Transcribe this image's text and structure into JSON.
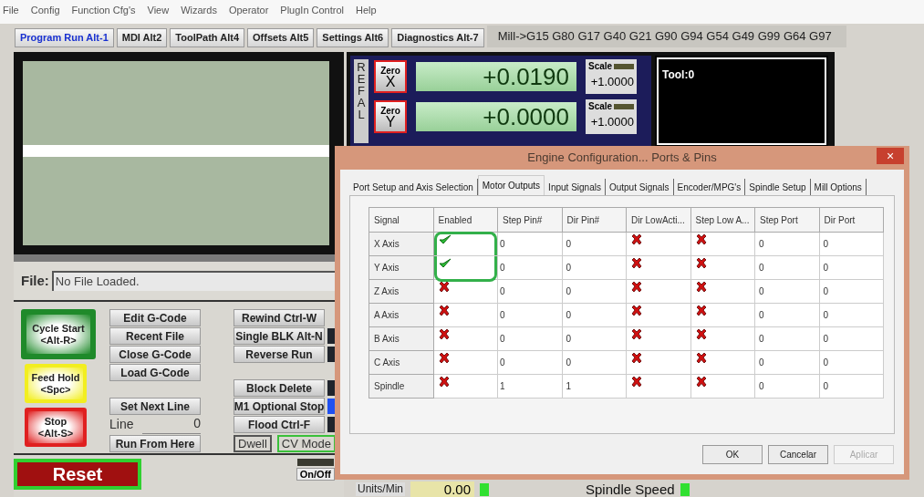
{
  "menu": [
    "File",
    "Config",
    "Function Cfg's",
    "View",
    "Wizards",
    "Operator",
    "PlugIn Control",
    "Help"
  ],
  "tabs": [
    {
      "label": "Program Run Alt-1",
      "selected": true
    },
    {
      "label": "MDI Alt2",
      "selected": false
    },
    {
      "label": "ToolPath Alt4",
      "selected": false
    },
    {
      "label": "Offsets Alt5",
      "selected": false
    },
    {
      "label": "Settings Alt6",
      "selected": false
    },
    {
      "label": "Diagnostics Alt-7",
      "selected": false
    }
  ],
  "modal_codes": "Mill->G15  G80 G17 G40 G21 G90 G94 G54 G49 G99 G64 G97",
  "file": {
    "label": "File:",
    "value": "No File Loaded."
  },
  "cycle_buttons": [
    {
      "lines": [
        "Cycle Start",
        "<Alt-R>"
      ],
      "color": "#1f8a2a"
    },
    {
      "lines": [
        "Feed Hold",
        "<Spc>"
      ],
      "color": "#f2ee20"
    },
    {
      "lines": [
        "Stop",
        "<Alt-S>"
      ],
      "color": "#e02020"
    }
  ],
  "program_buttons": [
    {
      "kind": "button",
      "label": "Edit G-Code"
    },
    {
      "kind": "button",
      "label": "Recent File"
    },
    {
      "kind": "button",
      "label": "Close G-Code"
    },
    {
      "kind": "button",
      "label": "Load G-Code"
    },
    {
      "kind": "gap"
    },
    {
      "kind": "button",
      "label": "Set Next Line"
    },
    {
      "kind": "line",
      "label": "Line",
      "value": "0"
    },
    {
      "kind": "button",
      "label": "Run From Here"
    }
  ],
  "control_buttons": [
    {
      "kind": "button",
      "label": "Rewind Ctrl-W"
    },
    {
      "kind": "toggle",
      "label": "Single BLK Alt-N",
      "on": false
    },
    {
      "kind": "toggle",
      "label": "Reverse Run",
      "on": false
    },
    {
      "kind": "gap"
    },
    {
      "kind": "toggle",
      "label": "Block Delete",
      "on": false
    },
    {
      "kind": "toggle",
      "label": "M1 Optional Stop",
      "on": true
    },
    {
      "kind": "toggle",
      "label": "Flood Ctrl-F",
      "on": false
    }
  ],
  "modes": [
    {
      "label": "Dwell",
      "active": false
    },
    {
      "label": "CV Mode",
      "active": true
    }
  ],
  "reset": "Reset",
  "coolant_toggle": "On/Off",
  "ref_all": "REFAL",
  "axes": [
    {
      "zero": "Zero",
      "axis": "X",
      "value": "+0.0190",
      "scale_label": "Scale",
      "scale": "+1.0000"
    },
    {
      "zero": "Zero",
      "axis": "Y",
      "value": "+0.0000",
      "scale_label": "Scale",
      "scale": "+1.0000"
    }
  ],
  "tool": "Tool:0",
  "feed": {
    "label": "Units/Min",
    "value": "0.00"
  },
  "spindle": {
    "label": "Spindle Speed"
  },
  "dialog": {
    "title": "Engine Configuration... Ports & Pins",
    "close": "×",
    "tabs": [
      {
        "label": "Port Setup and Axis Selection",
        "selected": false
      },
      {
        "label": "Motor Outputs",
        "selected": true
      },
      {
        "label": "Input Signals",
        "selected": false
      },
      {
        "label": "Output Signals",
        "selected": false
      },
      {
        "label": "Encoder/MPG's",
        "selected": false
      },
      {
        "label": "Spindle Setup",
        "selected": false
      },
      {
        "label": "Mill Options",
        "selected": false
      }
    ],
    "columns": [
      "Signal",
      "Enabled",
      "Step Pin#",
      "Dir Pin#",
      "Dir LowActi...",
      "Step Low A...",
      "Step Port",
      "Dir Port"
    ],
    "rows": [
      {
        "signal": "X Axis",
        "enabled": true,
        "step_pin": "0",
        "dir_pin": "0",
        "dir_low_active": false,
        "step_low_active": false,
        "step_port": "0",
        "dir_port": "0",
        "highlighted": true
      },
      {
        "signal": "Y Axis",
        "enabled": true,
        "step_pin": "0",
        "dir_pin": "0",
        "dir_low_active": false,
        "step_low_active": false,
        "step_port": "0",
        "dir_port": "0",
        "highlighted": true
      },
      {
        "signal": "Z Axis",
        "enabled": false,
        "step_pin": "0",
        "dir_pin": "0",
        "dir_low_active": false,
        "step_low_active": false,
        "step_port": "0",
        "dir_port": "0",
        "highlighted": false
      },
      {
        "signal": "A Axis",
        "enabled": false,
        "step_pin": "0",
        "dir_pin": "0",
        "dir_low_active": false,
        "step_low_active": false,
        "step_port": "0",
        "dir_port": "0",
        "highlighted": false
      },
      {
        "signal": "B Axis",
        "enabled": false,
        "step_pin": "0",
        "dir_pin": "0",
        "dir_low_active": false,
        "step_low_active": false,
        "step_port": "0",
        "dir_port": "0",
        "highlighted": false
      },
      {
        "signal": "C Axis",
        "enabled": false,
        "step_pin": "0",
        "dir_pin": "0",
        "dir_low_active": false,
        "step_low_active": false,
        "step_port": "0",
        "dir_port": "0",
        "highlighted": false
      },
      {
        "signal": "Spindle",
        "enabled": false,
        "step_pin": "1",
        "dir_pin": "1",
        "dir_low_active": false,
        "step_low_active": false,
        "step_port": "0",
        "dir_port": "0",
        "highlighted": false
      }
    ],
    "buttons": [
      {
        "label": "OK",
        "disabled": false
      },
      {
        "label": "Cancelar",
        "disabled": false
      },
      {
        "label": "Aplicar",
        "disabled": true
      }
    ]
  }
}
